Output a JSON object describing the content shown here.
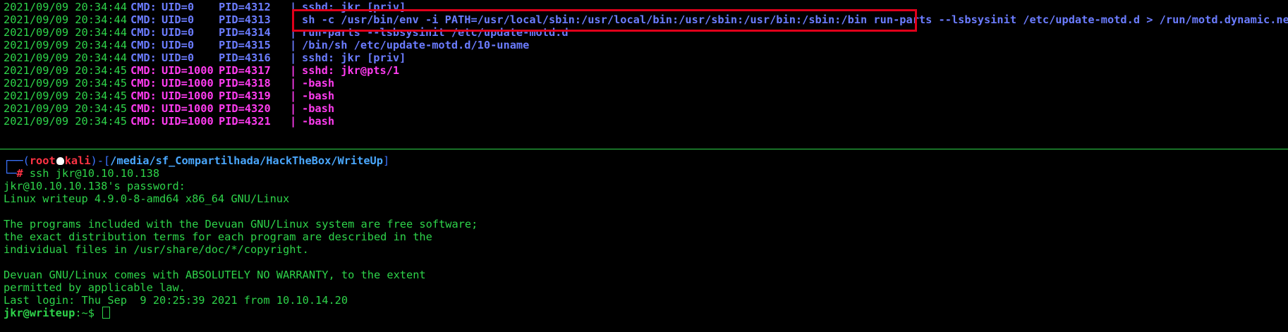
{
  "pspy_lines": [
    {
      "ts": "2021/09/09 20:34:44",
      "cmd": "CMD:",
      "uid": "UID=0",
      "pid": "PID=4312",
      "sep": "|",
      "text": "sshd: jkr [priv]",
      "kind": "root"
    },
    {
      "ts": "2021/09/09 20:34:44",
      "cmd": "CMD:",
      "uid": "UID=0",
      "pid": "PID=4313",
      "sep": "|",
      "text": "sh -c /usr/bin/env -i PATH=/usr/local/sbin:/usr/local/bin:/usr/sbin:/usr/bin:/sbin:/bin run-parts --lsbsysinit /etc/update-motd.d > /run/motd.dynamic.new",
      "kind": "root"
    },
    {
      "ts": "2021/09/09 20:34:44",
      "cmd": "CMD:",
      "uid": "UID=0",
      "pid": "PID=4314",
      "sep": "|",
      "text": "run-parts --lsbsysinit /etc/update-motd.d",
      "kind": "root"
    },
    {
      "ts": "2021/09/09 20:34:44",
      "cmd": "CMD:",
      "uid": "UID=0",
      "pid": "PID=4315",
      "sep": "|",
      "text": "/bin/sh /etc/update-motd.d/10-uname",
      "kind": "root"
    },
    {
      "ts": "2021/09/09 20:34:44",
      "cmd": "CMD:",
      "uid": "UID=0",
      "pid": "PID=4316",
      "sep": "|",
      "text": "sshd: jkr [priv]",
      "kind": "root"
    },
    {
      "ts": "2021/09/09 20:34:45",
      "cmd": "CMD:",
      "uid": "UID=1000",
      "pid": "PID=4317",
      "sep": "|",
      "text": "sshd: jkr@pts/1",
      "kind": "user"
    },
    {
      "ts": "2021/09/09 20:34:45",
      "cmd": "CMD:",
      "uid": "UID=1000",
      "pid": "PID=4318",
      "sep": "|",
      "text": "-bash",
      "kind": "user"
    },
    {
      "ts": "2021/09/09 20:34:45",
      "cmd": "CMD:",
      "uid": "UID=1000",
      "pid": "PID=4319",
      "sep": "|",
      "text": "-bash",
      "kind": "user"
    },
    {
      "ts": "2021/09/09 20:34:45",
      "cmd": "CMD:",
      "uid": "UID=1000",
      "pid": "PID=4320",
      "sep": "|",
      "text": "-bash",
      "kind": "user"
    },
    {
      "ts": "2021/09/09 20:34:45",
      "cmd": "CMD:",
      "uid": "UID=1000",
      "pid": "PID=4321",
      "sep": "|",
      "text": "-bash",
      "kind": "user"
    }
  ],
  "prompt": {
    "frame_top": "┌──(",
    "user": "root",
    "host": "kali",
    "frame_mid": ")-[",
    "path": "/media/sf_Compartilhada/HackTheBox/WriteUp",
    "frame_end": "]",
    "frame_bottom": "└─",
    "hash": "#",
    "command": " ssh jkr@10.10.10.138"
  },
  "session_lines": [
    "jkr@10.10.10.138's password:",
    "Linux writeup 4.9.0-8-amd64 x86_64 GNU/Linux",
    "",
    "The programs included with the Devuan GNU/Linux system are free software;",
    "the exact distribution terms for each program are described in the",
    "individual files in /usr/share/doc/*/copyright.",
    "",
    "Devuan GNU/Linux comes with ABSOLUTELY NO WARRANTY, to the extent",
    "permitted by applicable law.",
    "Last login: Thu Sep  9 20:25:39 2021 from 10.10.14.20"
  ],
  "final_prompt": {
    "user_host": "jkr@writeup",
    "suffix": ":~$ "
  },
  "colors": {
    "background": "#000000",
    "text_green": "#2ed44a",
    "root_blue": "#6b7cff",
    "user_magenta": "#ff3cf0",
    "highlight_red": "#e0001a"
  }
}
